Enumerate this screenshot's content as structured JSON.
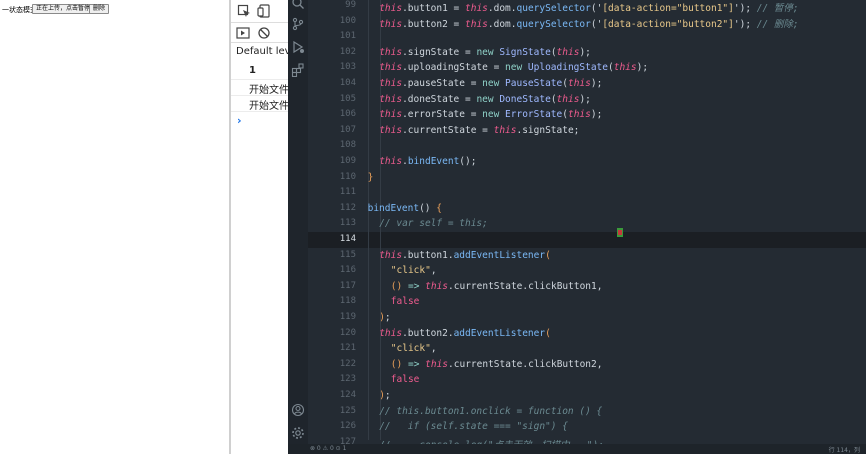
{
  "browser_page": {
    "title": "一状态模式",
    "buttons": [
      "正在上传，点击暂停",
      "删除"
    ]
  },
  "devtools": {
    "default_levels": "Default levels",
    "rows": [
      "1",
      "开始文件",
      "开始文件"
    ],
    "prompt": "›"
  },
  "editor": {
    "active_line": "114",
    "status_left": "⊗ 0 ⚠ 0 ⊙ 1",
    "status_right": "行 114，列",
    "lines": [
      {
        "n": "99",
        "indent": 2,
        "tokens": [
          [
            "k",
            "this"
          ],
          [
            "p",
            ".button1 = "
          ],
          [
            "k",
            "this"
          ],
          [
            "p",
            ".dom."
          ],
          [
            "f",
            "querySelector"
          ],
          [
            "p",
            "('"
          ],
          [
            "s",
            "[data-action=\"button1\"]"
          ],
          [
            "p",
            "'); "
          ],
          [
            "c",
            "// 暂停;"
          ]
        ]
      },
      {
        "n": "100",
        "indent": 2,
        "tokens": [
          [
            "k",
            "this"
          ],
          [
            "p",
            ".button2 = "
          ],
          [
            "k",
            "this"
          ],
          [
            "p",
            ".dom."
          ],
          [
            "f",
            "querySelector"
          ],
          [
            "p",
            "('"
          ],
          [
            "s",
            "[data-action=\"button2\"]"
          ],
          [
            "p",
            "'); "
          ],
          [
            "c",
            "// 删除;"
          ]
        ]
      },
      {
        "n": "101",
        "indent": 0,
        "tokens": []
      },
      {
        "n": "102",
        "indent": 2,
        "tokens": [
          [
            "k",
            "this"
          ],
          [
            "p",
            ".signState = "
          ],
          [
            "op",
            "new "
          ],
          [
            "cls",
            "SignState"
          ],
          [
            "p",
            "("
          ],
          [
            "k",
            "this"
          ],
          [
            "p",
            ");"
          ]
        ]
      },
      {
        "n": "103",
        "indent": 2,
        "tokens": [
          [
            "k",
            "this"
          ],
          [
            "p",
            ".uploadingState = "
          ],
          [
            "op",
            "new "
          ],
          [
            "cls",
            "UploadingState"
          ],
          [
            "p",
            "("
          ],
          [
            "k",
            "this"
          ],
          [
            "p",
            ");"
          ]
        ]
      },
      {
        "n": "104",
        "indent": 2,
        "tokens": [
          [
            "k",
            "this"
          ],
          [
            "p",
            ".pauseState = "
          ],
          [
            "op",
            "new "
          ],
          [
            "cls",
            "PauseState"
          ],
          [
            "p",
            "("
          ],
          [
            "k",
            "this"
          ],
          [
            "p",
            ");"
          ]
        ]
      },
      {
        "n": "105",
        "indent": 2,
        "tokens": [
          [
            "k",
            "this"
          ],
          [
            "p",
            ".doneState = "
          ],
          [
            "op",
            "new "
          ],
          [
            "cls",
            "DoneState"
          ],
          [
            "p",
            "("
          ],
          [
            "k",
            "this"
          ],
          [
            "p",
            ");"
          ]
        ]
      },
      {
        "n": "106",
        "indent": 2,
        "tokens": [
          [
            "k",
            "this"
          ],
          [
            "p",
            ".errorState = "
          ],
          [
            "op",
            "new "
          ],
          [
            "cls",
            "ErrorState"
          ],
          [
            "p",
            "("
          ],
          [
            "k",
            "this"
          ],
          [
            "p",
            ");"
          ]
        ]
      },
      {
        "n": "107",
        "indent": 2,
        "tokens": [
          [
            "k",
            "this"
          ],
          [
            "p",
            ".currentState = "
          ],
          [
            "k",
            "this"
          ],
          [
            "p",
            ".signState;"
          ]
        ]
      },
      {
        "n": "108",
        "indent": 0,
        "tokens": []
      },
      {
        "n": "109",
        "indent": 2,
        "tokens": [
          [
            "k",
            "this"
          ],
          [
            "p",
            "."
          ],
          [
            "f",
            "bindEvent"
          ],
          [
            "p",
            "();"
          ]
        ]
      },
      {
        "n": "110",
        "indent": 1,
        "tokens": [
          [
            "br",
            "}"
          ]
        ]
      },
      {
        "n": "111",
        "indent": 0,
        "tokens": []
      },
      {
        "n": "112",
        "indent": 1,
        "tokens": [
          [
            "f",
            "bindEvent"
          ],
          [
            "p",
            "() "
          ],
          [
            "br",
            "{"
          ]
        ]
      },
      {
        "n": "113",
        "indent": 2,
        "tokens": [
          [
            "c",
            "// var self = this;"
          ]
        ]
      },
      {
        "n": "114",
        "indent": 0,
        "tokens": []
      },
      {
        "n": "115",
        "indent": 2,
        "tokens": [
          [
            "k",
            "this"
          ],
          [
            "p",
            ".button1."
          ],
          [
            "f",
            "addEventListener"
          ],
          [
            "br",
            "("
          ]
        ]
      },
      {
        "n": "116",
        "indent": 3,
        "tokens": [
          [
            "s",
            "\"click\""
          ],
          [
            "p",
            ","
          ]
        ]
      },
      {
        "n": "117",
        "indent": 3,
        "tokens": [
          [
            "br",
            "()"
          ],
          [
            "op",
            " => "
          ],
          [
            "k",
            "this"
          ],
          [
            "p",
            ".currentState.clickButton1,"
          ]
        ]
      },
      {
        "n": "118",
        "indent": 3,
        "tokens": [
          [
            "bool",
            "false"
          ]
        ]
      },
      {
        "n": "119",
        "indent": 2,
        "tokens": [
          [
            "br",
            ")"
          ],
          [
            "p",
            ";"
          ]
        ]
      },
      {
        "n": "120",
        "indent": 2,
        "tokens": [
          [
            "k",
            "this"
          ],
          [
            "p",
            ".button2."
          ],
          [
            "f",
            "addEventListener"
          ],
          [
            "br",
            "("
          ]
        ]
      },
      {
        "n": "121",
        "indent": 3,
        "tokens": [
          [
            "s",
            "\"click\""
          ],
          [
            "p",
            ","
          ]
        ]
      },
      {
        "n": "122",
        "indent": 3,
        "tokens": [
          [
            "br",
            "()"
          ],
          [
            "op",
            " => "
          ],
          [
            "k",
            "this"
          ],
          [
            "p",
            ".currentState.clickButton2,"
          ]
        ]
      },
      {
        "n": "123",
        "indent": 3,
        "tokens": [
          [
            "bool",
            "false"
          ]
        ]
      },
      {
        "n": "124",
        "indent": 2,
        "tokens": [
          [
            "br",
            ")"
          ],
          [
            "p",
            ";"
          ]
        ]
      },
      {
        "n": "125",
        "indent": 2,
        "tokens": [
          [
            "c",
            "// this.button1.onclick = function () {"
          ]
        ]
      },
      {
        "n": "126",
        "indent": 2,
        "tokens": [
          [
            "c",
            "//   if (self.state === \"sign\") {"
          ]
        ]
      },
      {
        "n": "127",
        "indent": 2,
        "tokens": [
          [
            "c",
            "//     console.log(\"点击无效，扫描中...\");"
          ]
        ]
      }
    ]
  },
  "colors": {
    "editor_bg": "#242b33",
    "keyword": "#ef5c8f",
    "string": "#e8c88a",
    "function": "#7ab8f5",
    "comment": "#6b8a91"
  },
  "icons": {
    "devtools": [
      "inspect-element-icon",
      "device-toggle-icon",
      "sidebar-toggle-icon",
      "clear-console-icon"
    ],
    "activity": [
      "search-icon",
      "source-control-icon",
      "run-debug-icon",
      "extensions-icon",
      "account-icon",
      "settings-gear-icon"
    ]
  }
}
